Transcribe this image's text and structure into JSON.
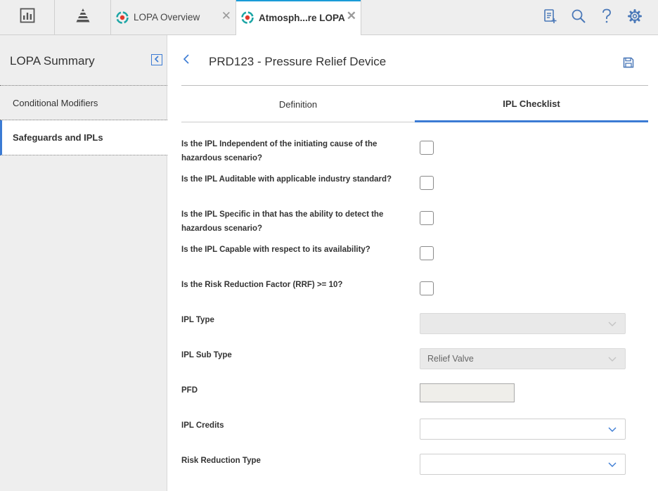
{
  "topbar": {
    "tabs": [
      {
        "label": "LOPA Overview",
        "close": "✕"
      },
      {
        "label": "Atmosph...re LOPA",
        "close": "✕"
      }
    ]
  },
  "sidebar": {
    "title": "LOPA Summary",
    "items": [
      {
        "label": "Conditional Modifiers"
      },
      {
        "label": "Safeguards and IPLs"
      }
    ]
  },
  "main": {
    "title": "PRD123 - Pressure Relief Device",
    "tabs": [
      {
        "label": "Definition"
      },
      {
        "label": "IPL Checklist"
      }
    ]
  },
  "checklist": [
    {
      "question": "Is the IPL Independent of the initiating cause of the hazardous scenario?",
      "checked": false
    },
    {
      "question": "Is the IPL Auditable with applicable industry standard?",
      "checked": false
    },
    {
      "question": "Is the IPL Specific in that has the ability to detect the hazardous scenario?",
      "checked": false
    },
    {
      "question": "Is the IPL Capable with respect to its availability?",
      "checked": false
    },
    {
      "question": "Is the Risk Reduction Factor (RRF) >= 10?",
      "checked": false
    }
  ],
  "fields": {
    "ipl_type": {
      "label": "IPL Type",
      "value": ""
    },
    "ipl_sub_type": {
      "label": "IPL Sub Type",
      "value": "Relief Valve"
    },
    "pfd": {
      "label": "PFD",
      "value": ""
    },
    "ipl_credits": {
      "label": "IPL Credits",
      "value": ""
    },
    "risk_reduction_type": {
      "label": "Risk Reduction Type",
      "value": ""
    }
  },
  "colors": {
    "accent": "#3b7bd4",
    "tab_indicator": "#1a9bd7",
    "logo_teal": "#1aa5a5",
    "logo_red": "#e2392b"
  }
}
